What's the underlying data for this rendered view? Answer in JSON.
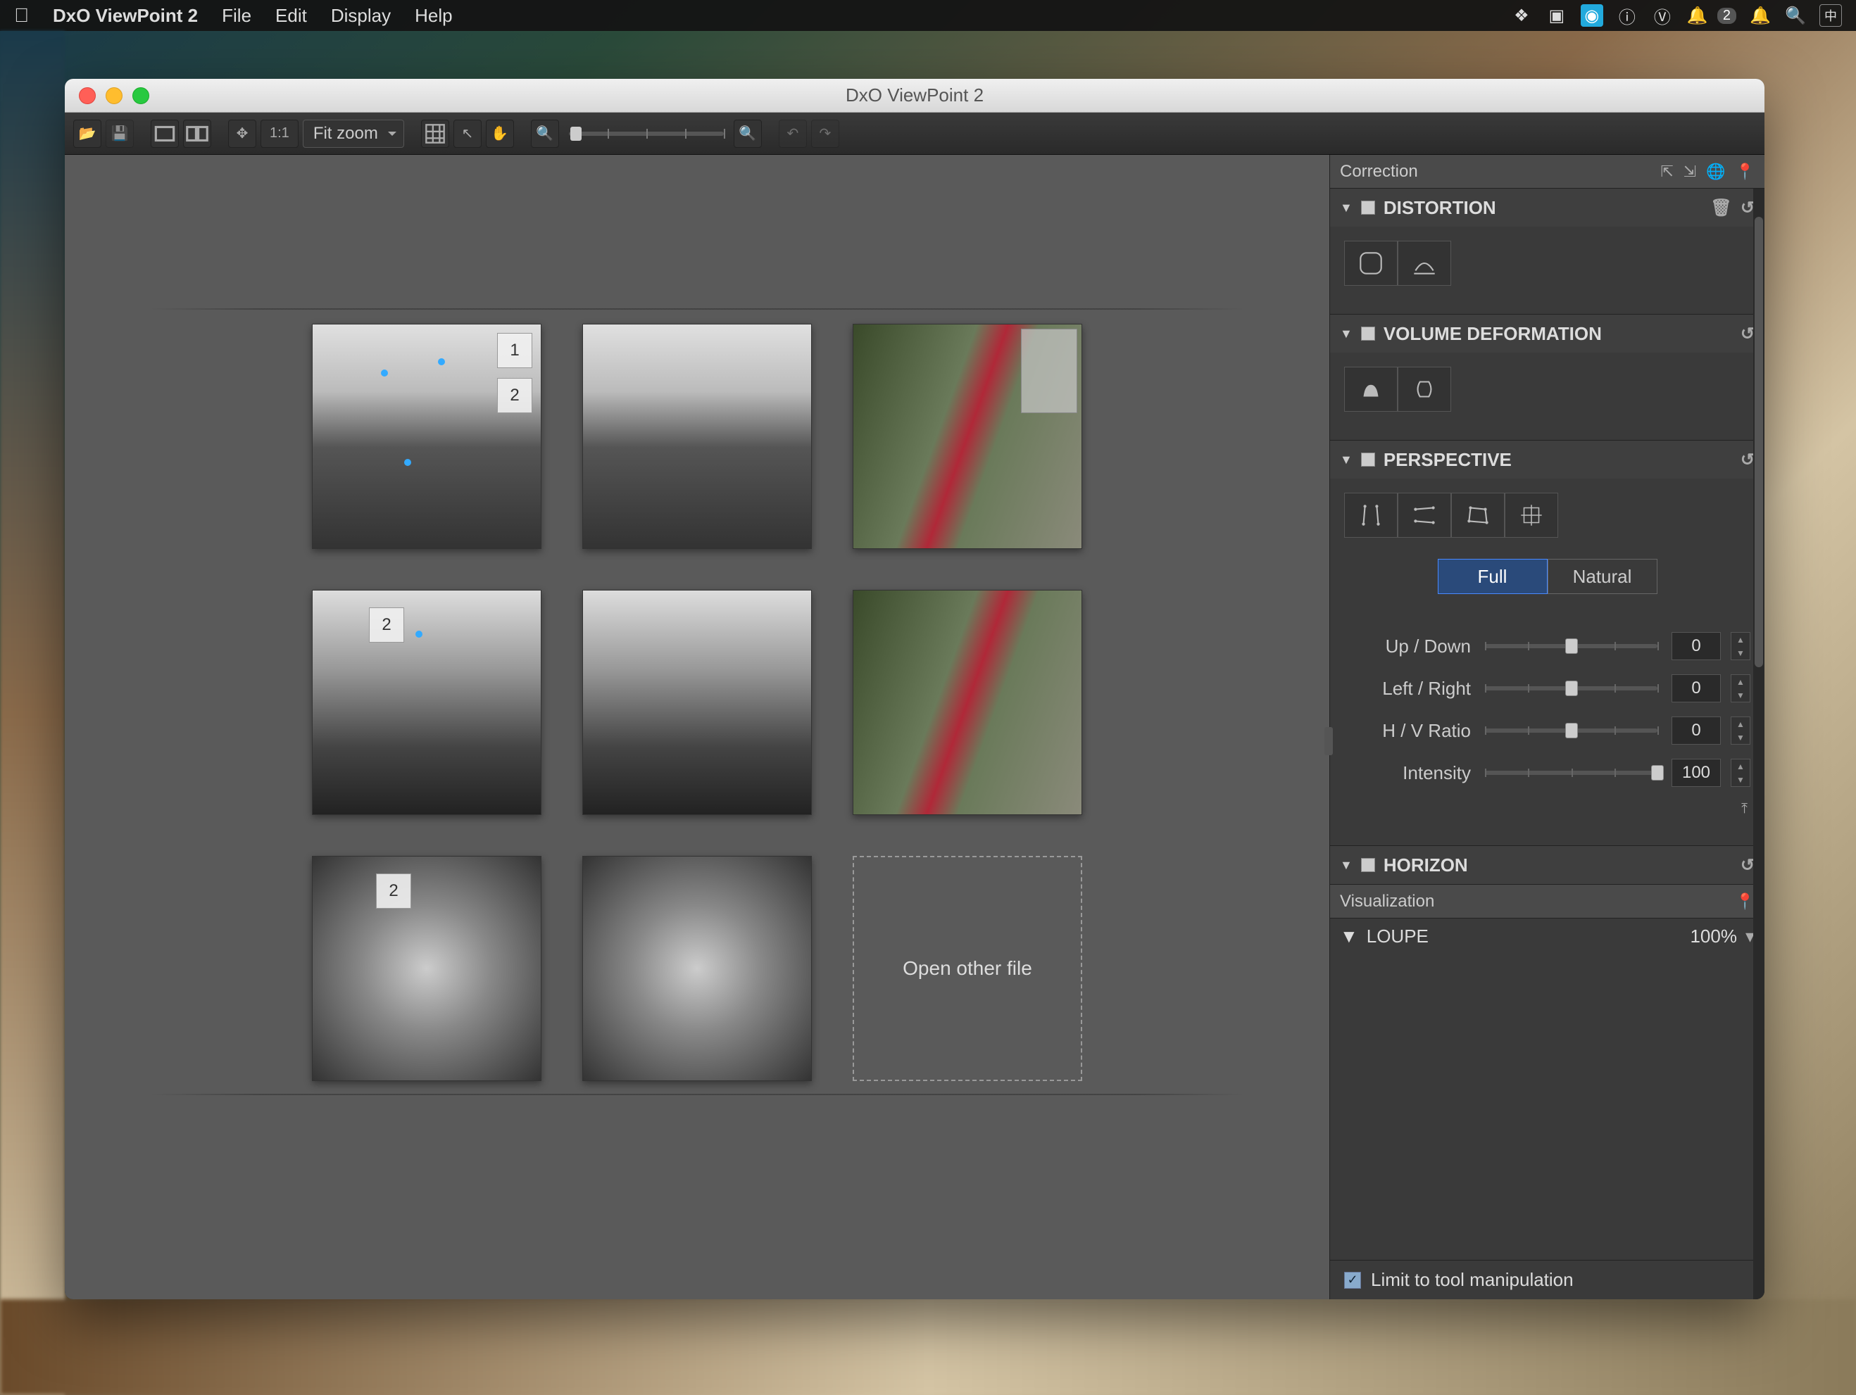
{
  "menubar": {
    "app_name": "DxO ViewPoint 2",
    "items": [
      "File",
      "Edit",
      "Display",
      "Help"
    ],
    "status_badge": "2"
  },
  "window": {
    "title": "DxO ViewPoint 2"
  },
  "toolbar": {
    "zoom_mode": "Fit zoom",
    "ratio_label": "1:1"
  },
  "canvas": {
    "open_other": "Open other file",
    "thumb_badges": {
      "t1a": "1",
      "t1b": "2",
      "t4": "2",
      "t7": "2"
    }
  },
  "panels": {
    "correction": {
      "title": "Correction",
      "sections": {
        "distortion": {
          "title": "DISTORTION"
        },
        "volume": {
          "title": "VOLUME DEFORMATION"
        },
        "perspective": {
          "title": "PERSPECTIVE",
          "seg_full": "Full",
          "seg_natural": "Natural",
          "sliders": {
            "updown": {
              "label": "Up / Down",
              "value": "0"
            },
            "leftright": {
              "label": "Left / Right",
              "value": "0"
            },
            "hvratio": {
              "label": "H / V Ratio",
              "value": "0"
            },
            "intensity": {
              "label": "Intensity",
              "value": "100"
            }
          }
        },
        "horizon": {
          "title": "HORIZON"
        }
      }
    },
    "visualization": {
      "title": "Visualization",
      "loupe": {
        "title": "LOUPE",
        "percent": "100%"
      },
      "limit_label": "Limit to tool manipulation"
    }
  }
}
